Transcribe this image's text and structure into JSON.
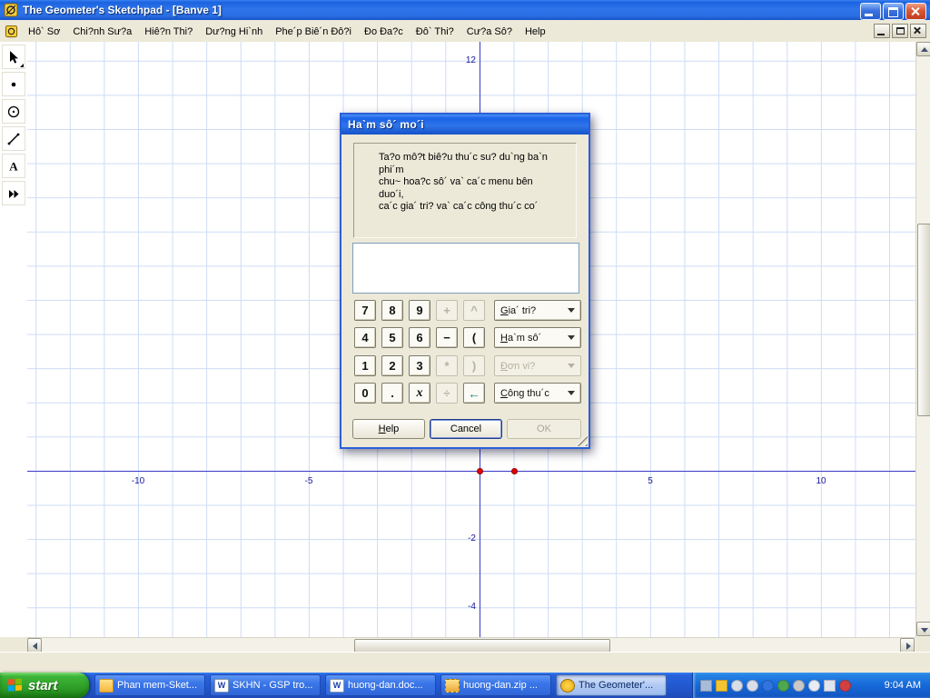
{
  "titlebar": {
    "title": "The Geometer's Sketchpad - [Banve 1]"
  },
  "menubar": {
    "items": [
      "Hô` Sơ",
      "Chi?nh Sư?a",
      "Hiê?n Thi?",
      "Dư?ng Hi`nh",
      "Phe´p Biê´n Đô?i",
      "Đo Đa?c",
      "Đô` Thi?",
      "Cư?a Sô?",
      "Help"
    ]
  },
  "toolbox": {
    "tools": [
      {
        "name": "selection-arrow-tool",
        "flyout": true
      },
      {
        "name": "point-tool",
        "flyout": false
      },
      {
        "name": "compass-tool",
        "flyout": false
      },
      {
        "name": "straightedge-tool",
        "flyout": false
      },
      {
        "name": "text-tool",
        "flyout": false
      },
      {
        "name": "custom-tool",
        "flyout": false
      }
    ]
  },
  "canvas": {
    "x_tick_labels": [
      {
        "value": -10
      },
      {
        "value": -5
      },
      {
        "value": 5
      },
      {
        "value": 10
      }
    ],
    "y_tick_labels": [
      {
        "value": 12
      },
      {
        "value": -2
      },
      {
        "value": -4
      }
    ],
    "points": [
      {
        "name": "origin-point",
        "x": 0,
        "y": 0
      },
      {
        "name": "unit-point",
        "x": 1,
        "y": 0
      }
    ],
    "grid_color": "#cddcf5",
    "axis_color": "#3b3bc8",
    "point_color": "#e30000"
  },
  "dialog": {
    "title": "Ha`m sô´ mo´i",
    "instruction_lines": [
      "Ta?o mô?t biê?u thu´c su? du`ng ba`n",
      "phi´m",
      "chu~ hoa?c sô´ va`  ca´c menu bên",
      "duo´i,",
      "ca´c gia´ tri? va`  ca´c công thu´c co´"
    ],
    "expression_value": "",
    "keypad_rows": [
      {
        "keys": [
          {
            "label": "7",
            "enabled": true
          },
          {
            "label": "8",
            "enabled": true
          },
          {
            "label": "9",
            "enabled": true
          },
          {
            "label": "+",
            "enabled": false
          },
          {
            "label": "^",
            "enabled": false
          }
        ],
        "dropdown": {
          "label": "Gia´ tri?",
          "enabled": true
        }
      },
      {
        "keys": [
          {
            "label": "4",
            "enabled": true
          },
          {
            "label": "5",
            "enabled": true
          },
          {
            "label": "6",
            "enabled": true
          },
          {
            "label": "−",
            "enabled": true
          },
          {
            "label": "(",
            "enabled": true
          }
        ],
        "dropdown": {
          "label": "Ha`m sô´",
          "enabled": true
        }
      },
      {
        "keys": [
          {
            "label": "1",
            "enabled": true
          },
          {
            "label": "2",
            "enabled": true
          },
          {
            "label": "3",
            "enabled": true
          },
          {
            "label": "*",
            "enabled": false
          },
          {
            "label": ")",
            "enabled": false
          }
        ],
        "dropdown": {
          "label": "Đơn vi?",
          "enabled": false
        }
      },
      {
        "keys": [
          {
            "label": "0",
            "enabled": true
          },
          {
            "label": ".",
            "enabled": true
          },
          {
            "label": "x",
            "enabled": true,
            "style": "italic"
          },
          {
            "label": "÷",
            "enabled": false
          },
          {
            "label": "←",
            "enabled": true,
            "style": "arrow"
          }
        ],
        "dropdown": {
          "label": "Công thu´c",
          "enabled": true
        }
      }
    ],
    "buttons": [
      {
        "label": "Help",
        "enabled": true,
        "default": false,
        "accel": true
      },
      {
        "label": "Cancel",
        "enabled": true,
        "default": true,
        "accel": false
      },
      {
        "label": "OK",
        "enabled": false,
        "default": false,
        "accel": false
      }
    ]
  },
  "taskbar": {
    "start_label": "start",
    "tasks": [
      {
        "label": "Phan mem-Sket...",
        "icon": "folder-icon",
        "active": false
      },
      {
        "label": "SKHN - GSP tro...",
        "icon": "word-icon",
        "active": false
      },
      {
        "label": "huong-dan.doc...",
        "icon": "word-icon",
        "active": false
      },
      {
        "label": "huong-dan.zip ...",
        "icon": "zip-icon",
        "active": false
      },
      {
        "label": "The Geometer'...",
        "icon": "gsp-icon",
        "active": true
      }
    ],
    "task_icon_glyphs": {
      "word-icon": "W"
    },
    "tray_icons": [
      "grid-icon",
      "yellow-v-icon",
      "round-icon",
      "round-icon",
      "download-icon",
      "ball-icon",
      "magnifier-icon",
      "clock-icon",
      "volume-icon",
      "red-badge-icon"
    ],
    "clock": "9:04 AM"
  }
}
